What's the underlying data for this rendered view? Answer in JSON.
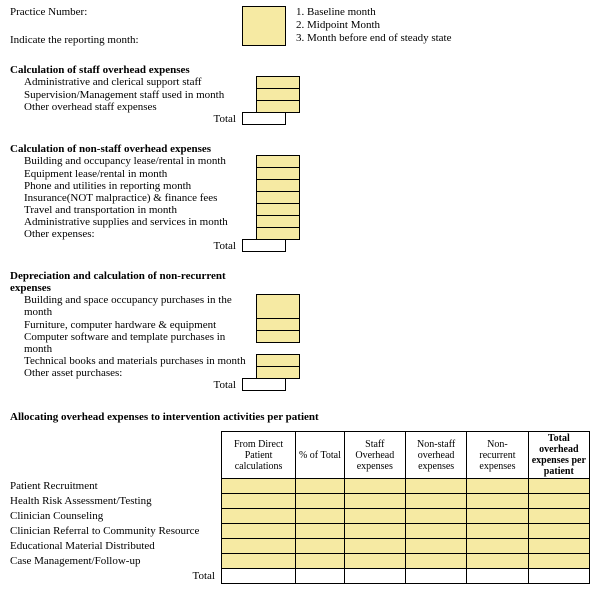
{
  "top": {
    "practice_label": "Practice Number:",
    "reporting_label": "Indicate the reporting month:",
    "notes": {
      "n1": "1. Baseline month",
      "n2": "2. Midpoint Month",
      "n3": "3. Month before end of steady state"
    }
  },
  "section1": {
    "title": "Calculation of staff overhead expenses",
    "items": {
      "i0": "Administrative and clerical support staff",
      "i1": "Supervision/Management staff used in month",
      "i2": "Other overhead staff expenses"
    },
    "total_label": "Total"
  },
  "section2": {
    "title": "Calculation of non-staff overhead expenses",
    "items": {
      "i0": "Building and occupancy lease/rental in month",
      "i1": "Equipment lease/rental in month",
      "i2": "Phone and utilities in reporting month",
      "i3": "Insurance(NOT malpractice) & finance fees",
      "i4": "Travel and transportation in month",
      "i5": "Administrative supplies and services in month",
      "i6": "Other expenses:"
    },
    "total_label": "Total"
  },
  "section3": {
    "title": "Depreciation and calculation of non-recurrent expenses",
    "items": {
      "i0": "Building and space occupancy purchases in the month",
      "i1": "Furniture, computer hardware & equipment",
      "i2": "Computer software and template purchases in month",
      "i3": "Technical books and materials purchases in month",
      "i4": "Other asset purchases:"
    },
    "total_label": "Total"
  },
  "alloc": {
    "title": "Allocating overhead expenses to intervention activities per patient",
    "headers": {
      "h0": "From Direct Patient calculations",
      "h1": "% of Total",
      "h2": "Staff Overhead expenses",
      "h3": "Non-staff overhead expenses",
      "h4": "Non-recurrent expenses",
      "h5": "Total overhead expenses per patient"
    },
    "rows": {
      "r0": "Patient Recruitment",
      "r1": "Health Risk Assessment/Testing",
      "r2": "Clinician Counseling",
      "r3": "Clinician Referral to Community Resource",
      "r4": "Educational Material Distributed",
      "r5": "Case Management/Follow-up"
    },
    "total_label": "Total"
  }
}
